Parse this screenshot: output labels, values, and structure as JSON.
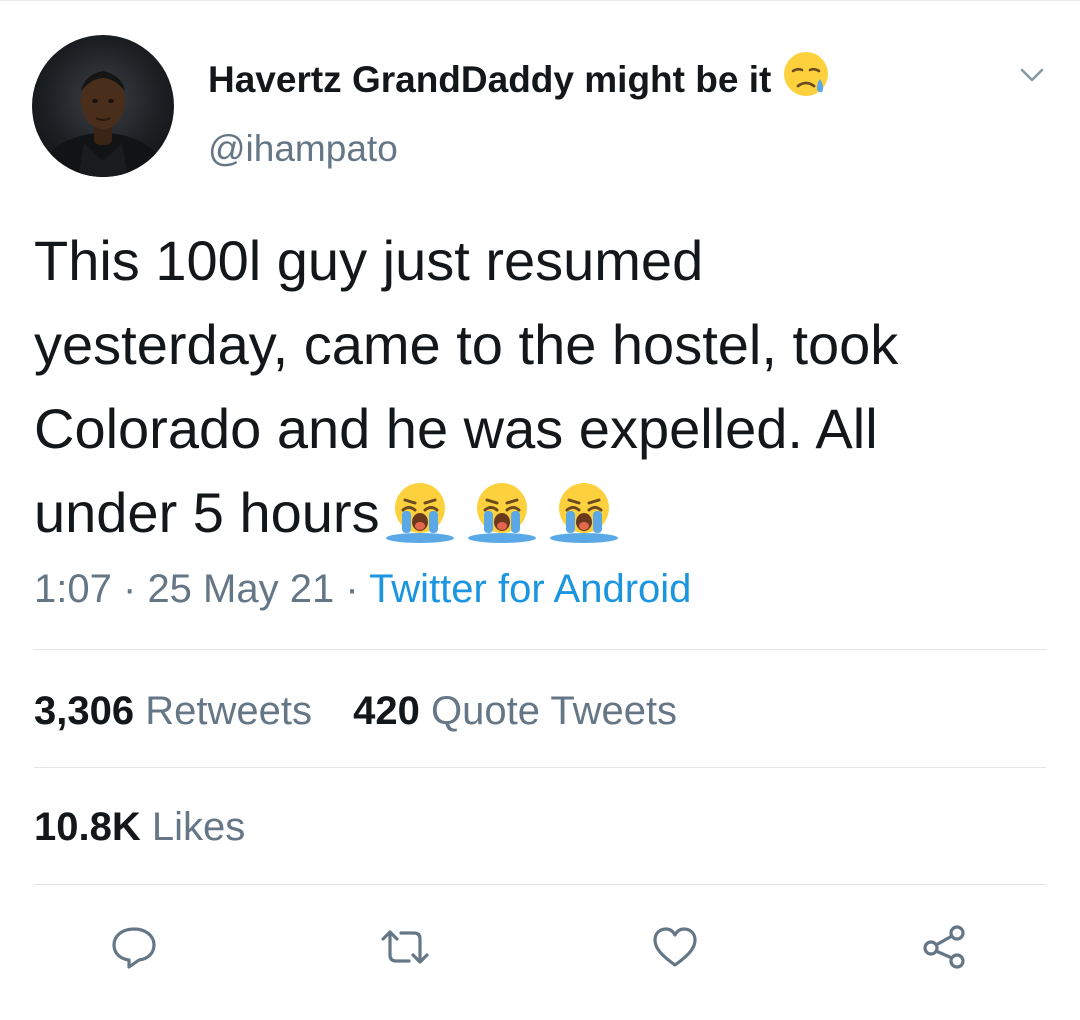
{
  "tweet": {
    "author": {
      "display_name": "Havertz GrandDaddy might be it",
      "name_emoji": "disappointed-relieved-emoji",
      "handle": "@ihampato"
    },
    "text_lines": [
      "This 100l guy just resumed",
      "yesterday, came to the hostel, took",
      "Colorado and he was expelled. All",
      "under 5 hours"
    ],
    "text_emojis": [
      "loudly-crying-emoji",
      "loudly-crying-emoji",
      "loudly-crying-emoji"
    ],
    "time": "1:07",
    "separator": "·",
    "date": "25 May 21",
    "source": "Twitter for Android"
  },
  "stats": {
    "retweets_count": "3,306",
    "retweets_label": "Retweets",
    "quotes_count": "420",
    "quotes_label": "Quote Tweets",
    "likes_count": "10.8K",
    "likes_label": "Likes"
  },
  "actions": {
    "reply_icon": "reply-icon",
    "retweet_icon": "retweet-icon",
    "like_icon": "heart-icon",
    "share_icon": "share-icon"
  },
  "colors": {
    "text": "#14171a",
    "secondary": "#657786",
    "link": "#1b95e0",
    "divider": "#dfe5ea",
    "emoji_face": "#fdd13e",
    "emoji_tears": "#5aa9e6"
  }
}
